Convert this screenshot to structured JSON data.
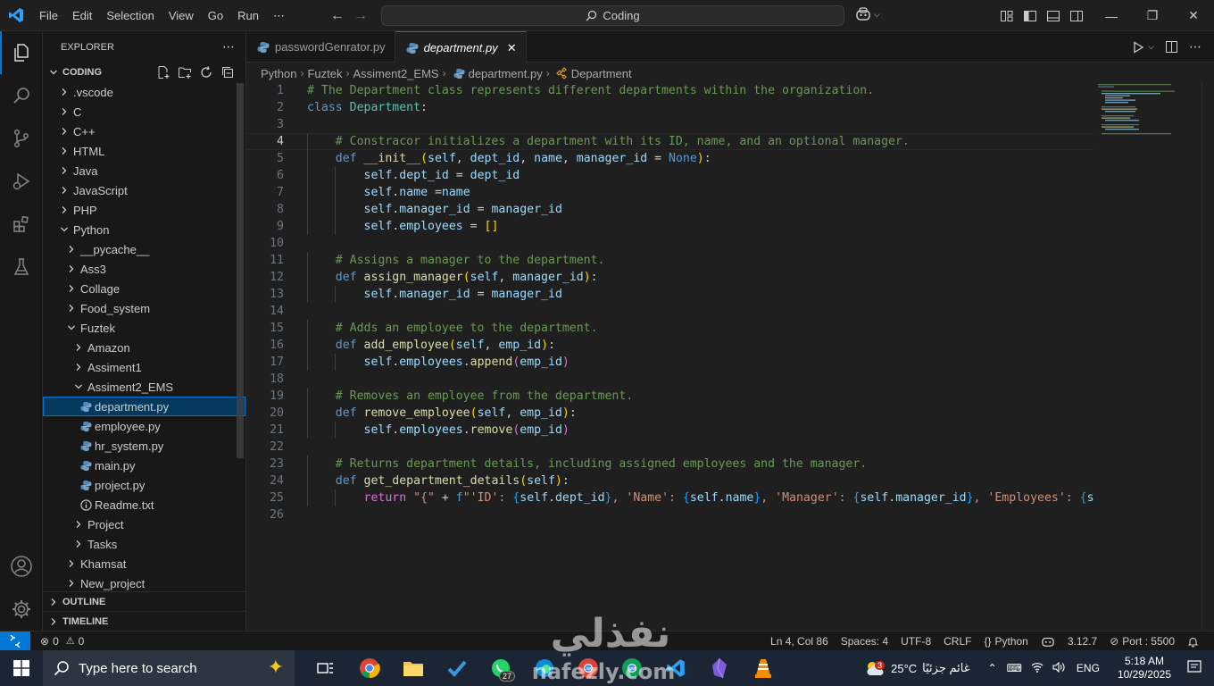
{
  "titlebar": {
    "menu": [
      "File",
      "Edit",
      "Selection",
      "View",
      "Go",
      "Run",
      "⋯"
    ],
    "search_label": "Coding"
  },
  "sidebar": {
    "title": "EXPLORER",
    "root": "CODING",
    "tree": [
      {
        "label": ".vscode",
        "indent": 0,
        "type": "folder",
        "open": false
      },
      {
        "label": "C",
        "indent": 0,
        "type": "folder",
        "open": false
      },
      {
        "label": "C++",
        "indent": 0,
        "type": "folder",
        "open": false
      },
      {
        "label": "HTML",
        "indent": 0,
        "type": "folder",
        "open": false
      },
      {
        "label": "Java",
        "indent": 0,
        "type": "folder",
        "open": false
      },
      {
        "label": "JavaScript",
        "indent": 0,
        "type": "folder",
        "open": false
      },
      {
        "label": "PHP",
        "indent": 0,
        "type": "folder",
        "open": false
      },
      {
        "label": "Python",
        "indent": 0,
        "type": "folder",
        "open": true
      },
      {
        "label": "__pycache__",
        "indent": 1,
        "type": "folder",
        "open": false
      },
      {
        "label": "Ass3",
        "indent": 1,
        "type": "folder",
        "open": false
      },
      {
        "label": "Collage",
        "indent": 1,
        "type": "folder",
        "open": false
      },
      {
        "label": "Food_system",
        "indent": 1,
        "type": "folder",
        "open": false
      },
      {
        "label": "Fuztek",
        "indent": 1,
        "type": "folder",
        "open": true
      },
      {
        "label": "Amazon",
        "indent": 2,
        "type": "folder",
        "open": false
      },
      {
        "label": "Assiment1",
        "indent": 2,
        "type": "folder",
        "open": false
      },
      {
        "label": "Assiment2_EMS",
        "indent": 2,
        "type": "folder",
        "open": true
      },
      {
        "label": "department.py",
        "indent": 3,
        "type": "py",
        "selected": true
      },
      {
        "label": "employee.py",
        "indent": 3,
        "type": "py"
      },
      {
        "label": "hr_system.py",
        "indent": 3,
        "type": "py"
      },
      {
        "label": "main.py",
        "indent": 3,
        "type": "py"
      },
      {
        "label": "project.py",
        "indent": 3,
        "type": "py"
      },
      {
        "label": "Readme.txt",
        "indent": 3,
        "type": "txt"
      },
      {
        "label": "Project",
        "indent": 2,
        "type": "folder",
        "open": false
      },
      {
        "label": "Tasks",
        "indent": 2,
        "type": "folder",
        "open": false
      },
      {
        "label": "Khamsat",
        "indent": 1,
        "type": "folder",
        "open": false
      },
      {
        "label": "New_project",
        "indent": 1,
        "type": "folder",
        "open": false
      }
    ],
    "outline": "OUTLINE",
    "timeline": "TIMELINE"
  },
  "tabs": [
    {
      "label": "passwordGenrator.py",
      "active": false
    },
    {
      "label": "department.py",
      "active": true
    }
  ],
  "breadcrumbs": [
    "Python",
    "Fuztek",
    "Assiment2_EMS",
    "department.py",
    "Department"
  ],
  "code": {
    "current_line": 4,
    "lines": [
      [
        [
          "c",
          "# The Department class represents different departments within the organization."
        ]
      ],
      [
        [
          "k",
          "class "
        ],
        [
          "t",
          "Department"
        ],
        [
          "p",
          ":"
        ]
      ],
      [],
      [
        [
          "p",
          "    "
        ],
        [
          "c",
          "# Constracor initializes a department with its ID, name, and an optional manager."
        ]
      ],
      [
        [
          "p",
          "    "
        ],
        [
          "k",
          "def "
        ],
        [
          "f",
          "__init__"
        ],
        [
          "b",
          "("
        ],
        [
          "v",
          "self"
        ],
        [
          "p",
          ", "
        ],
        [
          "v",
          "dept_id"
        ],
        [
          "p",
          ", "
        ],
        [
          "v",
          "name"
        ],
        [
          "p",
          ", "
        ],
        [
          "v",
          "manager_id"
        ],
        [
          "p",
          " = "
        ],
        [
          "k",
          "None"
        ],
        [
          "b",
          ")"
        ],
        [
          "p",
          ":"
        ]
      ],
      [
        [
          "p",
          "        "
        ],
        [
          "v",
          "self"
        ],
        [
          "p",
          "."
        ],
        [
          "v",
          "dept_id"
        ],
        [
          "p",
          " = "
        ],
        [
          "v",
          "dept_id"
        ]
      ],
      [
        [
          "p",
          "        "
        ],
        [
          "v",
          "self"
        ],
        [
          "p",
          "."
        ],
        [
          "v",
          "name"
        ],
        [
          "p",
          " ="
        ],
        [
          "v",
          "name"
        ]
      ],
      [
        [
          "p",
          "        "
        ],
        [
          "v",
          "self"
        ],
        [
          "p",
          "."
        ],
        [
          "v",
          "manager_id"
        ],
        [
          "p",
          " = "
        ],
        [
          "v",
          "manager_id"
        ]
      ],
      [
        [
          "p",
          "        "
        ],
        [
          "v",
          "self"
        ],
        [
          "p",
          "."
        ],
        [
          "v",
          "employees"
        ],
        [
          "p",
          " = "
        ],
        [
          "b",
          "[]"
        ]
      ],
      [],
      [
        [
          "p",
          "    "
        ],
        [
          "c",
          "# Assigns a manager to the department."
        ]
      ],
      [
        [
          "p",
          "    "
        ],
        [
          "k",
          "def "
        ],
        [
          "f",
          "assign_manager"
        ],
        [
          "b",
          "("
        ],
        [
          "v",
          "self"
        ],
        [
          "p",
          ", "
        ],
        [
          "v",
          "manager_id"
        ],
        [
          "b",
          ")"
        ],
        [
          "p",
          ":"
        ]
      ],
      [
        [
          "p",
          "        "
        ],
        [
          "v",
          "self"
        ],
        [
          "p",
          "."
        ],
        [
          "v",
          "manager_id"
        ],
        [
          "p",
          " = "
        ],
        [
          "v",
          "manager_id"
        ]
      ],
      [],
      [
        [
          "p",
          "    "
        ],
        [
          "c",
          "# Adds an employee to the department."
        ]
      ],
      [
        [
          "p",
          "    "
        ],
        [
          "k",
          "def "
        ],
        [
          "f",
          "add_employee"
        ],
        [
          "b",
          "("
        ],
        [
          "v",
          "self"
        ],
        [
          "p",
          ", "
        ],
        [
          "v",
          "emp_id"
        ],
        [
          "b",
          ")"
        ],
        [
          "p",
          ":"
        ]
      ],
      [
        [
          "p",
          "        "
        ],
        [
          "v",
          "self"
        ],
        [
          "p",
          "."
        ],
        [
          "v",
          "employees"
        ],
        [
          "p",
          "."
        ],
        [
          "f",
          "append"
        ],
        [
          "bp",
          "("
        ],
        [
          "v",
          "emp_id"
        ],
        [
          "bp",
          ")"
        ]
      ],
      [],
      [
        [
          "p",
          "    "
        ],
        [
          "c",
          "# Removes an employee from the department."
        ]
      ],
      [
        [
          "p",
          "    "
        ],
        [
          "k",
          "def "
        ],
        [
          "f",
          "remove_employee"
        ],
        [
          "b",
          "("
        ],
        [
          "v",
          "self"
        ],
        [
          "p",
          ", "
        ],
        [
          "v",
          "emp_id"
        ],
        [
          "b",
          ")"
        ],
        [
          "p",
          ":"
        ]
      ],
      [
        [
          "p",
          "        "
        ],
        [
          "v",
          "self"
        ],
        [
          "p",
          "."
        ],
        [
          "v",
          "employees"
        ],
        [
          "p",
          "."
        ],
        [
          "f",
          "remove"
        ],
        [
          "bp",
          "("
        ],
        [
          "v",
          "emp_id"
        ],
        [
          "bp",
          ")"
        ]
      ],
      [],
      [
        [
          "p",
          "    "
        ],
        [
          "c",
          "# Returns department details, including assigned employees and the manager."
        ]
      ],
      [
        [
          "p",
          "    "
        ],
        [
          "k",
          "def "
        ],
        [
          "f",
          "get_department_details"
        ],
        [
          "b",
          "("
        ],
        [
          "v",
          "self"
        ],
        [
          "b",
          ")"
        ],
        [
          "p",
          ":"
        ]
      ],
      [
        [
          "p",
          "        "
        ],
        [
          "bp",
          "return "
        ],
        [
          "s",
          "\"{\""
        ],
        [
          "p",
          " + "
        ],
        [
          "k",
          "f"
        ],
        [
          "s",
          "\"'ID': "
        ],
        [
          "bb",
          "{"
        ],
        [
          "v",
          "self"
        ],
        [
          "p",
          "."
        ],
        [
          "v",
          "dept_id"
        ],
        [
          "bb",
          "}"
        ],
        [
          "s",
          ", 'Name': "
        ],
        [
          "bb",
          "{"
        ],
        [
          "v",
          "self"
        ],
        [
          "p",
          "."
        ],
        [
          "v",
          "name"
        ],
        [
          "bb",
          "}"
        ],
        [
          "s",
          ", 'Manager': "
        ],
        [
          "bb",
          "{"
        ],
        [
          "v",
          "self"
        ],
        [
          "p",
          "."
        ],
        [
          "v",
          "manager_id"
        ],
        [
          "bb",
          "}"
        ],
        [
          "s",
          ", 'Employees': "
        ],
        [
          "bb",
          "{"
        ],
        [
          "v",
          "self."
        ]
      ],
      []
    ]
  },
  "statusbar": {
    "errors": "0",
    "warnings": "0",
    "position": "Ln 4, Col 86",
    "spaces": "Spaces: 4",
    "encoding": "UTF-8",
    "eol": "CRLF",
    "language": "Python",
    "python_version": "3.12.7",
    "port": "Port : 5500"
  },
  "taskbar": {
    "search_placeholder": "Type here to search",
    "whatsapp_badge": "27",
    "weather_badge": "3",
    "temperature": "25°C",
    "weather_text": "غائم جزئيًا",
    "language": "ENG",
    "time": "5:18 AM",
    "date": "10/29/2025"
  },
  "watermark": {
    "arabic": "نفذلي",
    "latin": "nafezly.com"
  },
  "colors": {
    "accent": "#0078d4",
    "comment": "#6a9955",
    "keyword": "#569cd6",
    "class": "#4ec9b0",
    "function": "#dcdcaa",
    "variable": "#9cdcfe",
    "string": "#ce9178"
  }
}
